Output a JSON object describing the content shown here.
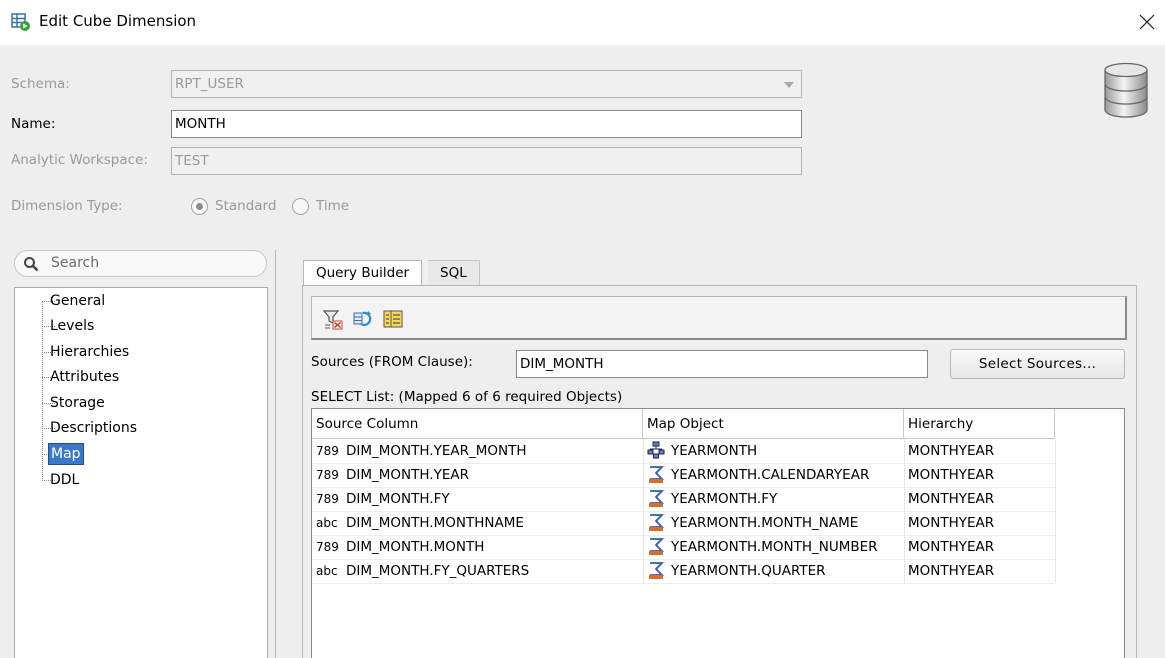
{
  "window": {
    "title": "Edit Cube Dimension",
    "icon": "dimension-edit-icon",
    "close_icon": "close-x-icon"
  },
  "form": {
    "schema_label": "Schema:",
    "schema_value": "RPT_USER",
    "name_label": "Name:",
    "name_value": "MONTH",
    "workspace_label": "Analytic Workspace:",
    "workspace_value": "TEST",
    "dimtype_label": "Dimension Type:",
    "dimtype_options": [
      {
        "label": "Standard",
        "selected": true
      },
      {
        "label": "Time",
        "selected": false
      }
    ]
  },
  "search": {
    "placeholder": "Search",
    "icon": "magnifier-icon"
  },
  "nav": {
    "items": [
      {
        "label": "General"
      },
      {
        "label": "Levels"
      },
      {
        "label": "Hierarchies"
      },
      {
        "label": "Attributes"
      },
      {
        "label": "Storage"
      },
      {
        "label": "Descriptions"
      },
      {
        "label": "Map",
        "selected": true
      },
      {
        "label": "DDL"
      }
    ]
  },
  "tabs": [
    {
      "label": "Query Builder",
      "active": true
    },
    {
      "label": "SQL",
      "active": false
    }
  ],
  "toolbar": {
    "buttons": [
      "filter-clear-icon",
      "refresh-icon",
      "column-list-icon"
    ]
  },
  "sources": {
    "label": "Sources (FROM Clause):",
    "value": "DIM_MONTH",
    "button": "Select Sources..."
  },
  "select_list": {
    "label": "SELECT List: (Mapped 6 of 6 required Objects)",
    "columns": [
      "Source Column",
      "Map Object",
      "Hierarchy"
    ],
    "rows": [
      {
        "type": "789",
        "source": "DIM_MONTH.YEAR_MONTH",
        "map_icon": "hierarchy-icon",
        "map": "YEARMONTH",
        "hierarchy": "MONTHYEAR"
      },
      {
        "type": "789",
        "source": "DIM_MONTH.YEAR",
        "map_icon": "attribute-map-icon",
        "map": "YEARMONTH.CALENDARYEAR",
        "hierarchy": "MONTHYEAR"
      },
      {
        "type": "789",
        "source": "DIM_MONTH.FY",
        "map_icon": "attribute-map-icon",
        "map": "YEARMONTH.FY",
        "hierarchy": "MONTHYEAR"
      },
      {
        "type": "abc",
        "source": "DIM_MONTH.MONTHNAME",
        "map_icon": "attribute-map-icon",
        "map": "YEARMONTH.MONTH_NAME",
        "hierarchy": "MONTHYEAR"
      },
      {
        "type": "789",
        "source": "DIM_MONTH.MONTH",
        "map_icon": "attribute-map-icon",
        "map": "YEARMONTH.MONTH_NUMBER",
        "hierarchy": "MONTHYEAR"
      },
      {
        "type": "abc",
        "source": "DIM_MONTH.FY_QUARTERS",
        "map_icon": "attribute-map-icon",
        "map": "YEARMONTH.QUARTER",
        "hierarchy": "MONTHYEAR"
      }
    ]
  },
  "colors": {
    "selection": "#3c78c8",
    "disabled_text": "#9a9a9a"
  }
}
